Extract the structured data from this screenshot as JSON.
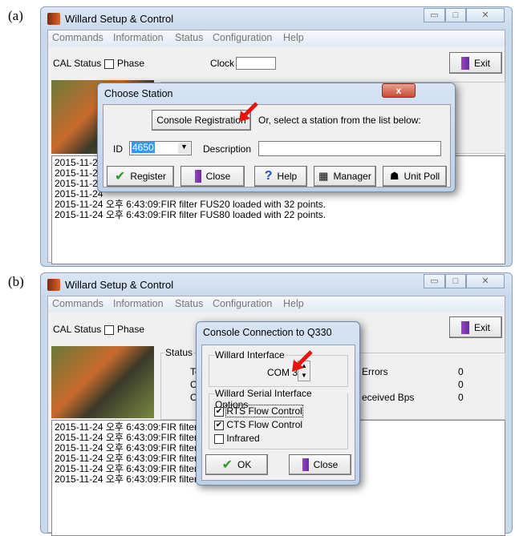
{
  "panels": [
    {
      "label": "(a)",
      "window": {
        "title": "Willard Setup & Control",
        "menu": [
          "Commands",
          "Information",
          "Status",
          "Configuration",
          "Help"
        ],
        "cal_status": "CAL Status",
        "phase": "Phase",
        "clock": "Clock",
        "exit": "Exit",
        "log": [
          "2015-11-24",
          "2015-11-24",
          "2015-11-24",
          "2015-11-24",
          "2015-11-24 오후 6:43:09:FIR filter FUS20 loaded with 32 points.",
          "2015-11-24 오후 6:43:09:FIR filter FUS80 loaded with 22 points."
        ]
      },
      "dialog": {
        "title": "Choose Station",
        "close": "x",
        "console_registration": "Console Registration",
        "hint": "Or, select a station from the list below:",
        "id_label": "ID",
        "id_value": "4650",
        "description_label": "Description",
        "description_value": "",
        "buttons": [
          "Register",
          "Close",
          "Help",
          "Manager",
          "Unit Poll"
        ]
      }
    },
    {
      "label": "(b)",
      "window": {
        "title": "Willard Setup & Control",
        "menu": [
          "Commands",
          "Information",
          "Status",
          "Configuration",
          "Help"
        ],
        "cal_status": "CAL Status",
        "phase": "Phase",
        "exit": "Exit",
        "status_group": "Status",
        "status_rows_left": [
          "Te",
          "Co",
          "O"
        ],
        "status_rows_right": [
          {
            "label": "Errors",
            "value": "0"
          },
          {
            "label": "",
            "value": "0"
          },
          {
            "label": "eceived Bps",
            "value": "0"
          }
        ],
        "log": [
          "2015-11-24 오후 6:43:09:FIR filter DE",
          "2015-11-24 오후 6:43:09:FIR filter VL",
          "2015-11-24 오후 6:43:09:FIR filter UL",
          "2015-11-24 오후 6:43:09:FIR filter US",
          "2015-11-24 오후 6:43:09:FIR filter FU",
          "2015-11-24 오후 6:43:09:FIR filter FU"
        ]
      },
      "dialog": {
        "title": "Console Connection to Q330",
        "interface_group": "Willard Interface",
        "com_port": "COM 3",
        "options_group": "Willard Serial Interface Options",
        "options": [
          {
            "label": "RTS Flow Control",
            "checked": true
          },
          {
            "label": "CTS Flow Control",
            "checked": true
          },
          {
            "label": "Infrared",
            "checked": false
          }
        ],
        "ok": "OK",
        "close": "Close"
      }
    }
  ],
  "colors": {
    "arrow": "#e8140c",
    "selection": "#3399ff"
  }
}
